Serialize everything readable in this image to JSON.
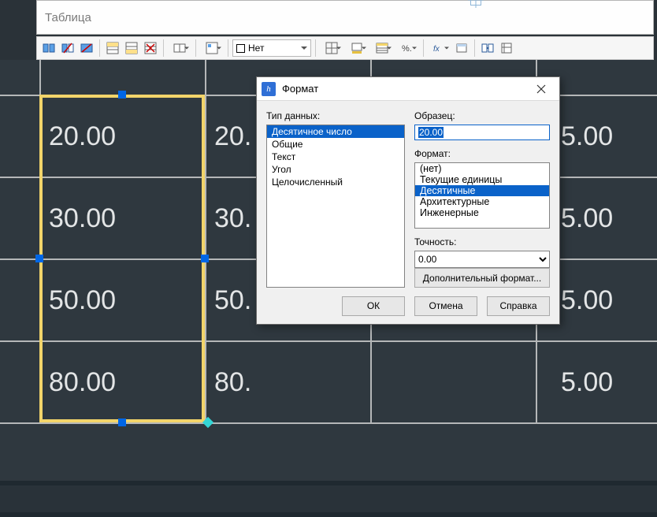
{
  "formula_bar_text": "Таблица",
  "toolbar": {
    "style_label": "Нет",
    "buttons": [
      "link-cell",
      "unlink-cell",
      "break-link",
      "tb-sep",
      "insert-row-above",
      "insert-row-below",
      "delete-row",
      "tb-sep",
      "merge-cells",
      "tb-sep",
      "cell-align",
      "tb-sep",
      "style-select",
      "tb-sep",
      "borders",
      "fill-color",
      "table-style",
      "percent-format",
      "tb-sep",
      "formula",
      "insert-field",
      "tb-sep",
      "link-table",
      "final"
    ]
  },
  "grid": {
    "rows": [
      "20.00",
      "30.00",
      "50.00",
      "80.00"
    ],
    "col2_prefix": [
      "20.",
      "30.",
      "50.",
      "80."
    ],
    "right_vals": [
      "5.00",
      "5.00",
      "5.00",
      "5.00"
    ]
  },
  "dialog": {
    "title": "Формат",
    "data_type_label": "Тип данных:",
    "data_types": [
      "Десятичное число",
      "Общие",
      "Текст",
      "Угол",
      "Целочисленный"
    ],
    "data_type_selected": 0,
    "sample_label": "Образец:",
    "sample_value": "20.00",
    "format_label": "Формат:",
    "formats": [
      "(нет)",
      "Текущие единицы",
      "Десятичные",
      "Архитектурные",
      "Инженерные"
    ],
    "format_selected": 2,
    "precision_label": "Точность:",
    "precision_value": "0.00",
    "extra_button": "Дополнительный формат...",
    "ok": "ОК",
    "cancel": "Отмена",
    "help": "Справка"
  },
  "colors": {
    "selection": "#f2d46a",
    "grip": "#0066e6"
  }
}
